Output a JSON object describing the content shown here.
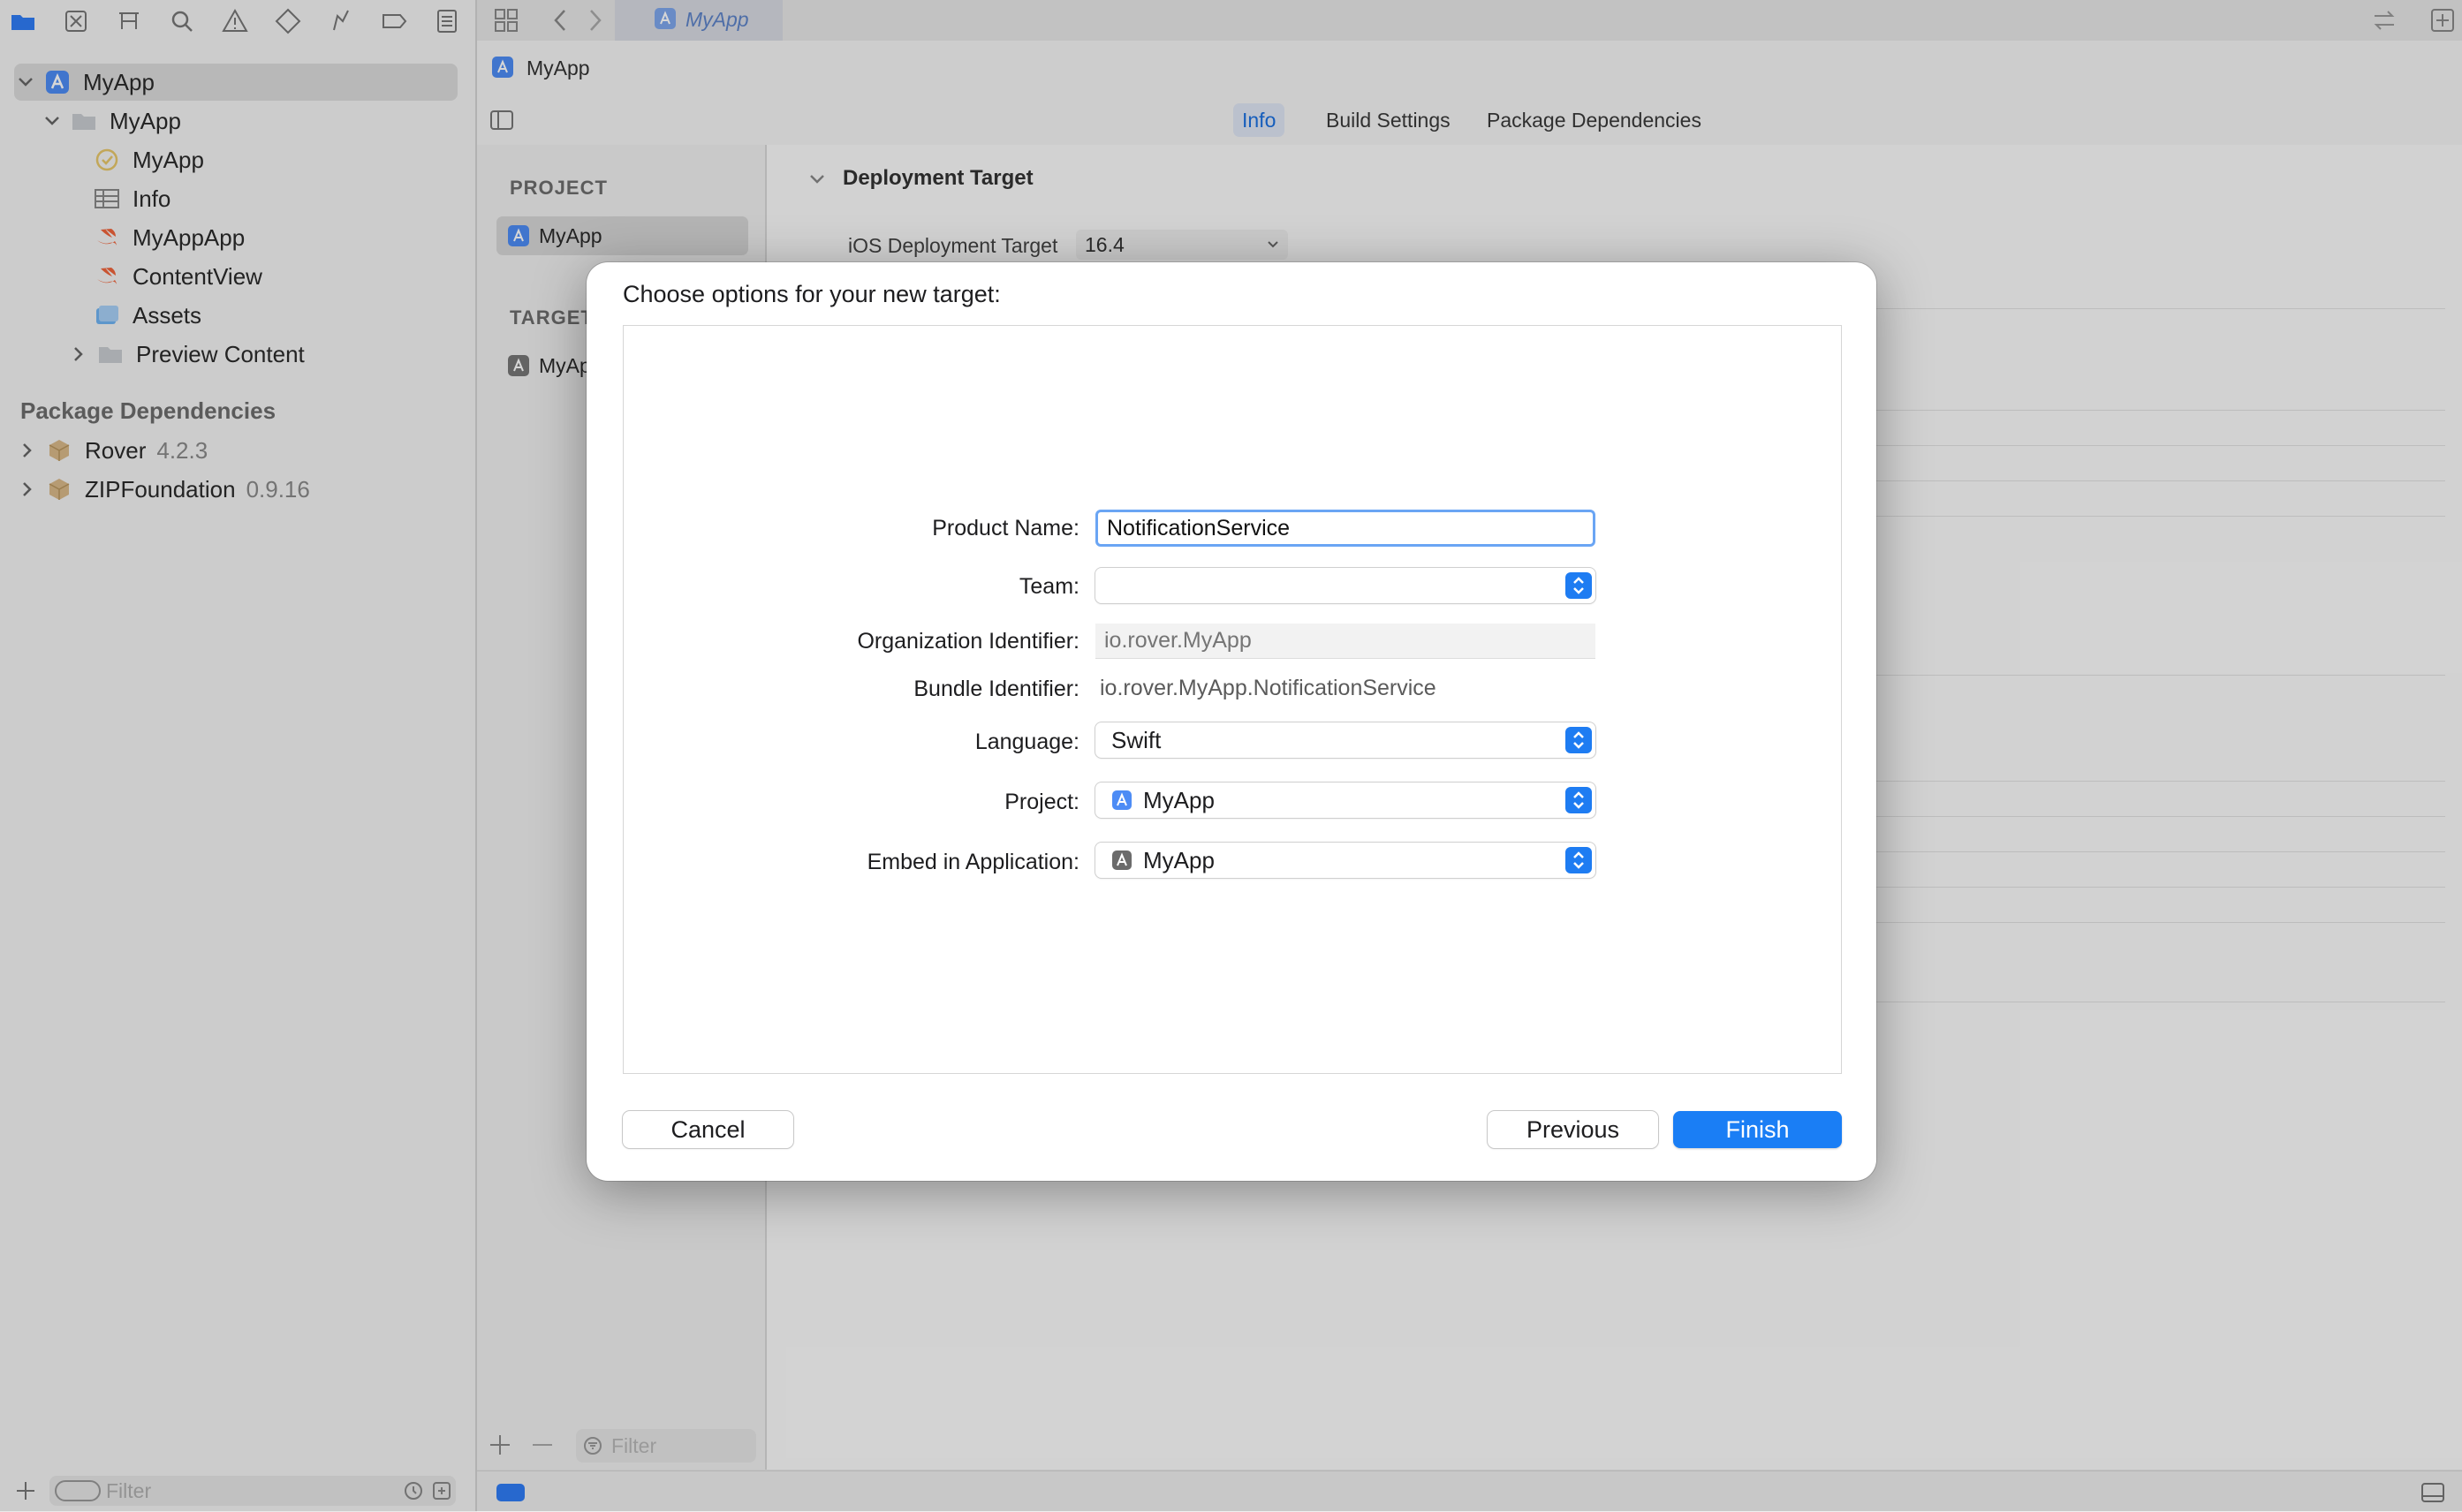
{
  "window": {
    "active_tab": "MyApp"
  },
  "navigator": {
    "tree": [
      {
        "label": "MyApp",
        "kind": "project"
      },
      {
        "label": "MyApp",
        "kind": "group"
      },
      {
        "label": "MyApp",
        "kind": "entitlements"
      },
      {
        "label": "Info",
        "kind": "plist"
      },
      {
        "label": "MyAppApp",
        "kind": "swift"
      },
      {
        "label": "ContentView",
        "kind": "swift"
      },
      {
        "label": "Assets",
        "kind": "assets"
      },
      {
        "label": "Preview Content",
        "kind": "folder"
      }
    ],
    "package_header": "Package Dependencies",
    "packages": [
      {
        "name": "Rover",
        "version": "4.2.3"
      },
      {
        "name": "ZIPFoundation",
        "version": "0.9.16"
      }
    ],
    "filter_placeholder": "Filter"
  },
  "editor": {
    "breadcrumb": "MyApp",
    "tabs": [
      "Info",
      "Build Settings",
      "Package Dependencies"
    ],
    "selected_tab": "Info",
    "project_header": "PROJECT",
    "project_item": "MyApp",
    "targets_header": "TARGETS",
    "target_item": "MyApp",
    "section_title": "Deployment Target",
    "ios_target_label": "iOS Deployment Target",
    "ios_target_value": "16.4",
    "list_filter_placeholder": "Filter"
  },
  "dialog": {
    "title": "Choose options for your new target:",
    "fields": {
      "product_name": {
        "label": "Product Name:",
        "value": "NotificationService"
      },
      "team": {
        "label": "Team:",
        "value": ""
      },
      "org_identifier": {
        "label": "Organization Identifier:",
        "placeholder": "io.rover.MyApp"
      },
      "bundle_identifier": {
        "label": "Bundle Identifier:",
        "value": "io.rover.MyApp.NotificationService"
      },
      "language": {
        "label": "Language:",
        "value": "Swift"
      },
      "project": {
        "label": "Project:",
        "value": "MyApp"
      },
      "embed": {
        "label": "Embed in Application:",
        "value": "MyApp"
      }
    },
    "buttons": {
      "cancel": "Cancel",
      "previous": "Previous",
      "finish": "Finish"
    }
  },
  "colors": {
    "accent": "#1a7ef5",
    "focus_ring": "#6aa5f4"
  }
}
